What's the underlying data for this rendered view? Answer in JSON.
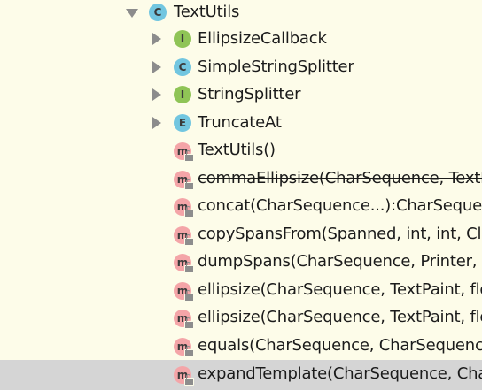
{
  "tree": {
    "root": {
      "label": "TextUtils",
      "icon": "class-icon",
      "icon_letter": "C",
      "expanded": true
    },
    "children": [
      {
        "label": "EllipsizeCallback",
        "kind": "interface",
        "icon_letter": "I",
        "expandable": true
      },
      {
        "label": "SimpleStringSplitter",
        "kind": "class",
        "icon_letter": "C",
        "expandable": true
      },
      {
        "label": "StringSplitter",
        "kind": "interface",
        "icon_letter": "I",
        "expandable": true
      },
      {
        "label": "TruncateAt",
        "kind": "enum",
        "icon_letter": "E",
        "expandable": true
      },
      {
        "label": "TextUtils()",
        "kind": "method",
        "icon_letter": "m",
        "locked": true
      },
      {
        "label": "commaEllipsize(CharSequence, TextPaint, float, String, String)",
        "kind": "method",
        "icon_letter": "m",
        "deprecated": true
      },
      {
        "label": "concat(CharSequence...):CharSequence",
        "kind": "method",
        "icon_letter": "m"
      },
      {
        "label": "copySpansFrom(Spanned, int, int, Class, Spannable, int)",
        "kind": "method",
        "icon_letter": "m"
      },
      {
        "label": "dumpSpans(CharSequence, Printer, String)",
        "kind": "method",
        "icon_letter": "m"
      },
      {
        "label": "ellipsize(CharSequence, TextPaint, float, TruncateAt)",
        "kind": "method",
        "icon_letter": "m"
      },
      {
        "label": "ellipsize(CharSequence, TextPaint, float, TruncateAt, boolean, EllipsizeCallback)",
        "kind": "method",
        "icon_letter": "m"
      },
      {
        "label": "equals(CharSequence, CharSequence):boolean",
        "kind": "method",
        "icon_letter": "m"
      },
      {
        "label": "expandTemplate(CharSequence, CharSequence...):CharSequence",
        "kind": "method",
        "icon_letter": "m",
        "selected": true
      }
    ]
  },
  "colors": {
    "background": "#fdfce9",
    "selection": "#d5d5d5",
    "class_icon": "#72c6e0",
    "interface_icon": "#8fc456",
    "method_icon": "#f4a5a8"
  }
}
